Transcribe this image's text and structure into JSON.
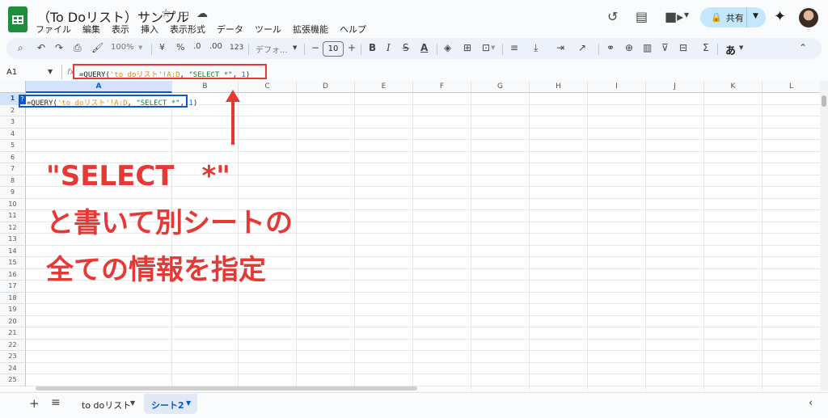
{
  "title": "（To Doリスト）サンプル",
  "menu": [
    "ファイル",
    "編集",
    "表示",
    "挿入",
    "表示形式",
    "データ",
    "ツール",
    "拡張機能",
    "ヘルプ"
  ],
  "share": {
    "label": "共有"
  },
  "toolbar": {
    "zoom": "100%",
    "font": "デフォ...",
    "font_size": "10",
    "currency": "¥",
    "percent": "%",
    "dec_less": ".0",
    "dec_more": ".00",
    "number_format": "123",
    "ime": "あ"
  },
  "name_box": "A1",
  "fx": "fx",
  "formula": {
    "p1": "=QUERY(",
    "p2": "'to doリスト'!A:D",
    "p3": ", ",
    "p4": "\"SELECT *\"",
    "p5": ", ",
    "p6": "1",
    "p7": ")"
  },
  "columns": [
    "A",
    "B",
    "C",
    "D",
    "E",
    "F",
    "G",
    "H",
    "I",
    "J",
    "K",
    "L"
  ],
  "rows": [
    "1",
    "2",
    "3",
    "4",
    "5",
    "6",
    "7",
    "8",
    "9",
    "10",
    "11",
    "12",
    "13",
    "14",
    "15",
    "16",
    "17",
    "18",
    "19",
    "20",
    "21",
    "22",
    "23",
    "24",
    "25"
  ],
  "cell_help": "?",
  "annotation": {
    "line1": "\"SELECT　*\"",
    "line2": "と書いて別シートの",
    "line3": "全ての情報を指定"
  },
  "tabs": [
    {
      "label": "to doリスト"
    },
    {
      "label": "シート2",
      "active": true
    }
  ],
  "colors": {
    "accent": "#0b57d0",
    "annotation": "#e53935",
    "sheets_green": "#1e8e3e"
  }
}
